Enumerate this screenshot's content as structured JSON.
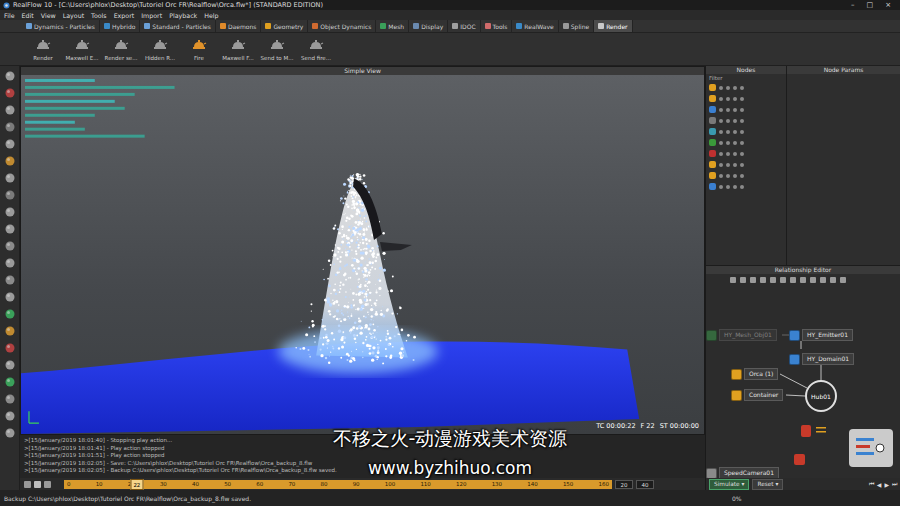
{
  "window": {
    "title": "RealFlow 10 - [C:\\Users\\phlox\\Desktop\\Tutoriel Orc FR\\Realflow\\Orca.flw*] (STANDARD EDITION)",
    "controls": [
      "–",
      "□",
      "×"
    ]
  },
  "menu": [
    "File",
    "Edit",
    "View",
    "Layout",
    "Tools",
    "Export",
    "Import",
    "Playback",
    "Help"
  ],
  "tabs": [
    {
      "label": "Dynamics - Particles",
      "selected": false,
      "color": "#6aa0d8"
    },
    {
      "label": "Hybrido",
      "selected": false,
      "color": "#3a8ac8"
    },
    {
      "label": "Standard - Particles",
      "selected": false,
      "color": "#6aa0d8"
    },
    {
      "label": "Daemons",
      "selected": false,
      "color": "#e08a2a"
    },
    {
      "label": "Geometry",
      "selected": false,
      "color": "#e0a020"
    },
    {
      "label": "Object Dynamics",
      "selected": false,
      "color": "#d06a30"
    },
    {
      "label": "Mesh",
      "selected": false,
      "color": "#3aa05a"
    },
    {
      "label": "Display",
      "selected": false,
      "color": "#6a8ab0"
    },
    {
      "label": "IDOC",
      "selected": false,
      "color": "#a0a0a0"
    },
    {
      "label": "Tools",
      "selected": false,
      "color": "#d06a6a"
    },
    {
      "label": "RealWave",
      "selected": false,
      "color": "#3a8ac8"
    },
    {
      "label": "Spline",
      "selected": false,
      "color": "#9a9a9a"
    },
    {
      "label": "Render",
      "selected": true,
      "color": "#c8c8c8"
    }
  ],
  "toolbar": [
    {
      "label": "Render",
      "color": "#9a9a9a"
    },
    {
      "label": "Maxwell E...",
      "color": "#9a9a9a"
    },
    {
      "label": "Render se...",
      "color": "#9a9a9a"
    },
    {
      "label": "Hidden R...",
      "color": "#9a9a9a"
    },
    {
      "label": "Fire",
      "color": "#e0922a"
    },
    {
      "label": "Maxwell F...",
      "color": "#9a9a9a"
    },
    {
      "label": "Send to M...",
      "color": "#9a9a9a"
    },
    {
      "label": "Send fire...",
      "color": "#9a9a9a"
    }
  ],
  "viewport": {
    "title": "Simple View",
    "readout": [
      "TC 00:00:22",
      "F 22",
      "ST 00:00:00"
    ]
  },
  "nodes_panel": {
    "title": "Nodes",
    "filter": "Filter",
    "rows": [
      {
        "color": "#e0a020"
      },
      {
        "color": "#e0a020"
      },
      {
        "color": "#3a7fd0"
      },
      {
        "color": "#7a7a7a"
      },
      {
        "color": "#3a9ab0"
      },
      {
        "color": "#3a9a3a"
      },
      {
        "color": "#c03030"
      },
      {
        "color": "#e0a020"
      },
      {
        "color": "#e0a020"
      },
      {
        "color": "#3a7fd0"
      }
    ]
  },
  "params_panel": {
    "title": "Node Params"
  },
  "relationship": {
    "title": "Relationship Editor",
    "hub": "Hub01",
    "nodes": [
      {
        "label": "HY_Mesh_Obj01",
        "disabled": true,
        "color": "#3d9a4d"
      },
      {
        "label": "HY_Emitter01",
        "disabled": false,
        "color": "#3a82d0"
      },
      {
        "label": "HY_Domain01",
        "disabled": false,
        "color": "#3a82d0"
      },
      {
        "label": "Orca (1)",
        "disabled": false,
        "color": "#e0a020"
      },
      {
        "label": "Container",
        "disabled": false,
        "color": "#e0a020"
      },
      {
        "label": "SpeedCamera01",
        "disabled": false,
        "color": "#8a8a8a"
      }
    ]
  },
  "console": [
    ">[15/January/2019 18:01:40] - Stopping play action...",
    ">[15/January/2019 18:01:41] - Play action stopped",
    ">[15/January/2019 18:01:51] - Play action stopped",
    ">[15/January/2019 18:02:05] - Save: C:\\Users\\phlox\\Desktop\\Tutoriel Orc FR\\Realflow\\Orca_backup_8.flw",
    ">[15/January/2019 18:02:05] - Backup C:\\Users\\phlox\\Desktop\\Tutoriel Orc FR\\Realflow\\Orca_backup_8.flw saved."
  ],
  "timeline": {
    "ticks": [
      "0",
      "10",
      "20",
      "30",
      "40",
      "50",
      "60",
      "70",
      "80",
      "90",
      "100",
      "110",
      "120",
      "130",
      "140",
      "150",
      "160"
    ],
    "current": "22",
    "playhead": {
      "level": 0.133
    },
    "fields": [
      "20",
      "40"
    ]
  },
  "sim": {
    "simulate": "Simulate ▾",
    "reset": "Reset ▾",
    "controls": [
      "⏮",
      "◀",
      "▶",
      "⏭"
    ]
  },
  "status_bar": {
    "message": "Backup C:\\Users\\phlox\\Desktop\\Tutoriel Orc FR\\Realflow\\Orca_backup_8.flw saved.",
    "progress": "0%"
  },
  "watermark": [
    "不移之火-动漫游戏美术资源",
    "www.byzhihuo.com"
  ]
}
